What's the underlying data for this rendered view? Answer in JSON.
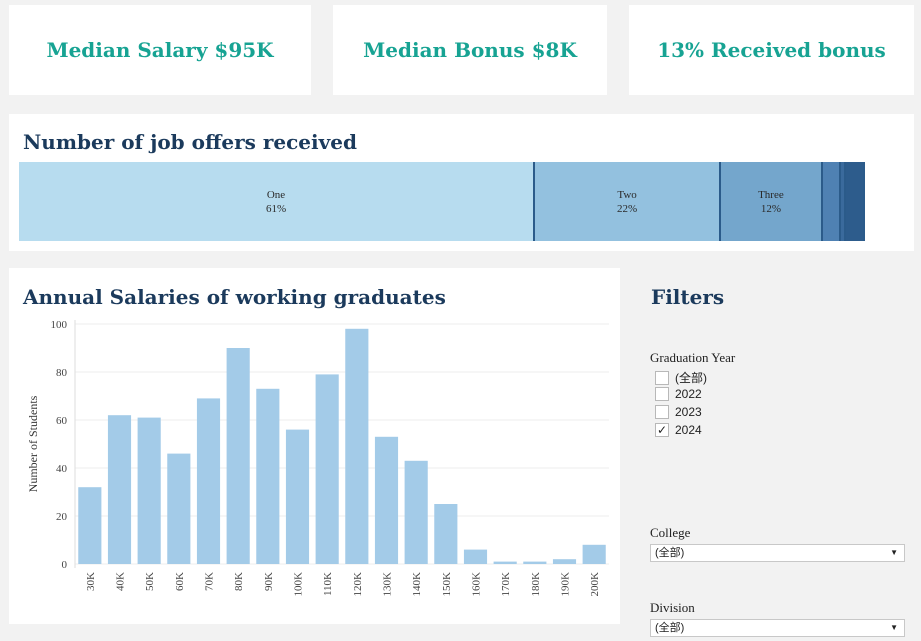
{
  "kpis": {
    "median_salary": "Median Salary $95K",
    "median_bonus": "Median Bonus $8K",
    "received_bonus": "13% Received bonus"
  },
  "offers": {
    "title": "Number of job offers received",
    "segments": [
      {
        "label": "One",
        "pct_label": "61%",
        "share": 61,
        "color": "#b7dcef"
      },
      {
        "label": "Two",
        "pct_label": "22%",
        "share": 22,
        "color": "#93c1df"
      },
      {
        "label": "Three",
        "pct_label": "12%",
        "share": 12,
        "color": "#74a6cc"
      },
      {
        "label": "",
        "pct_label": "",
        "share": 2.2,
        "color": "#4f81b3"
      },
      {
        "label": "",
        "pct_label": "",
        "share": 0.6,
        "color": "#3a6a9c"
      },
      {
        "label": "",
        "pct_label": "",
        "share": 2.2,
        "color": "#2d5c8c"
      }
    ]
  },
  "salary_chart": {
    "title": "Annual Salaries of working graduates"
  },
  "chart_data": {
    "type": "bar",
    "categories": [
      "30K",
      "40K",
      "50K",
      "60K",
      "70K",
      "80K",
      "90K",
      "100K",
      "110K",
      "120K",
      "130K",
      "140K",
      "150K",
      "160K",
      "170K",
      "180K",
      "190K",
      "200K"
    ],
    "values": [
      32,
      62,
      61,
      46,
      69,
      90,
      73,
      56,
      79,
      98,
      53,
      43,
      25,
      6,
      1,
      1,
      2,
      8
    ],
    "ylabel": "Number of Students",
    "xlabel": "",
    "ylim": [
      0,
      100
    ],
    "yticks": [
      0,
      20,
      40,
      60,
      80,
      100
    ],
    "bar_color": "#a3cbe8",
    "grid": true
  },
  "filters": {
    "title": "Filters",
    "graduation_year": {
      "label": "Graduation Year",
      "options": [
        {
          "label": "(全部)",
          "checked": false
        },
        {
          "label": "2022",
          "checked": false
        },
        {
          "label": "2023",
          "checked": false
        },
        {
          "label": "2024",
          "checked": true
        }
      ]
    },
    "college": {
      "label": "College",
      "value": "(全部)"
    },
    "division": {
      "label": "Division",
      "value": "(全部)"
    }
  }
}
